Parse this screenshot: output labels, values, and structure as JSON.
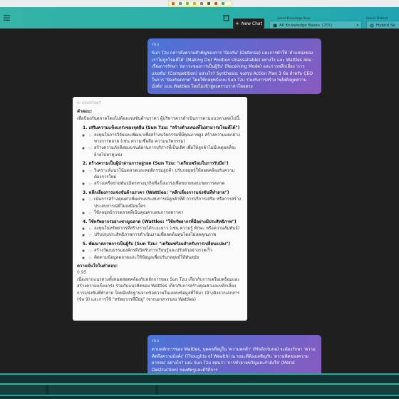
{
  "header": {
    "new_chat_label": "New Chat",
    "kb_label": "Select Knowledge Base",
    "kb_value": "All Knowledge Bases",
    "kb_count": "(201)",
    "sm_label": "Search Method",
    "sm_value": "Hybrid Se"
  },
  "messages": {
    "user1": {
      "role": "YOU",
      "text": "Sun Tzu กล่าวถึงความสำคัญของการ 'ป้องกัน' (Defense) และการทำให้ 'ตำแหน่งของเราไม่ถูกโจมตีได้' (Making Our Position Unassailable) อย่างไร และ Wattles สอนเรื่องการรักษา 'สภาวะของการเป็นผู้รับ' (Receiving Mode) และการหลีกเลี่ยง 'การแข่งขัน' (Competition) อย่างไร? Synthesis: จงสรุป Action Plan 3 ข้อ สำหรับ CEO ในการ 'ป้องกันตลาด' โดยใช้กลยุทธ์แบบ Sun Tzu ร่วมกับการสร้าง 'พลังดึงดูดความมั่งคั่ง' แบบ Wattles โดยไม่เข้าสู่สงครามราคาโดยตรง"
    },
    "ai": {
      "role": "AI ASSISTANT",
      "answer_heading": "คำตอบ:",
      "intro": "เพื่อป้องกันตลาดโดยไม่ต้องแข่งขันด้านราคา ผู้บริหารควรดำเนินการตามแนวทางต่อไปนี้:",
      "sections": [
        {
          "title": "1. เสริมความแข็งแกร่งของจุดยืน (Sun Tzu: \"สร้างตำแหน่งที่ไม่สามารถโจมตีได้\")",
          "bullets": [
            "ลงทุนในการวิจัยและพัฒนาเพื่อสร้างนวัตกรรมที่มีคุณภาพสูง สร้างความแตกต่างทางการตลาด (เช่น ความเชื่อถือ ความนวัตกรรม)",
            "สร้างความภักดีต่อแบรนด์ผ่านการบริการที่เป็นเลิศ เพื่อให้ลูกค้าไม่มีเหตุผลที่จะย้ายไปหาคู่แข่ง"
          ]
        },
        {
          "title": "2. สร้างความเป็นผู้นำผ่านการอยู่รอด (Sun Tzu: \"เตรียมพร้อมในการรับมือ\")",
          "bullets": [
            "วิเคราะห์แนวโน้มตลาดและพฤติกรรมลูกค้า ปรับกลยุทธ์ให้สอดคล้องกับความต้องการใหม่",
            "สร้างเครือข่ายพันธมิตรทางธุรกิจที่แข็งแกร่งเพื่อขยายขอบเขตการตลาด"
          ]
        },
        {
          "title": "3. หลีกเลี่ยงการแข่งขันด้านราคา (Wattles: \"หลีกเลี่ยงการแข่งขันที่ทำลาย\")",
          "bullets": [
            "เน้นการสร้างคุณค่าเพิ่มผ่านประสบการณ์ลูกค้าที่ดี การบริการเสริม หรือการสร้างประสบการณ์ที่ไม่เหมือนใคร",
            "ใช้กลยุทธ์การตลาดที่เน้นคุณค่าแทนการลดราคา"
          ]
        },
        {
          "title": "4. ใช้ทรัพยากรอย่างชาญฉลาด (Wattles: \"ใช้ทรัพยากรที่มีอย่างมีประสิทธิภาพ\")",
          "bullets": [
            "ลงทุนในทรัพยากรที่สร้างรายได้ระยะยาว (เช่น ความรู้ ทักษะ หรือความสัมพันธ์)",
            "ปรับปรุงประสิทธิภาพการดำเนินงานเพื่อลดต้นทุนโดยไม่ลดคุณภาพ"
          ]
        },
        {
          "title": "5. พัฒนาสภาพการเป็นผู้รับ (Sun Tzu: \"เตรียมพร้อมสำหรับการเปลี่ยนแปลง\")",
          "bullets": [
            "สร้างวัฒนธรรมองค์กรที่เปิดรับการเรียนรู้และปรับตัวอย่างรวดเร็ว",
            "ติดตามข้อมูลตลาดและใช้ข้อมูลเพื่อปรับกลยุทธ์ให้ทันสมัย"
          ]
        }
      ],
      "confidence_label": "ความมั่นใจในคำตอบ:",
      "confidence_value": "0.95",
      "closing": "เนื่องจากแนวทางทั้งหมดสอดคล้องกับหลักการของ Sun Tzu เกี่ยวกับการเตรียมพร้อมและสร้างความแข็งแกร่ง ร่วมกับแนวคิดของ Wattles เกี่ยวกับการสร้างคุณค่าและหลีกเลี่ยงการแข่งขันที่ทำลาย โดยมีหลักฐานจากข้อความในแหล่งข้อมูลที่ให้มา (อ้างอิงจากเอกสาร (ข้อ 9) และการใช้ \"ทรัพยากรที่มีอยู่\" (จากเอกสารของ Wattles)"
    },
    "user2": {
      "role": "YOU",
      "text": "ตามหลักการของ Wattles, บุคคลที่อยู่ใน 'ความตกต่ำ' (Misfortune) จะต้องรักษา 'ความคิดถึงความมั่งคั่ง' (Thoughts of Wealth) ณ ขณะที่ต้องเผชิญกับ 'ความคิดของความยากจน' อย่างไร? และ Sun Tzu สอนว่า 'การทำลายขวัญและกำลังใจ' (Moral Destruction) ของศัตรูและมีวิธีการ"
    }
  },
  "colors": {
    "accent_teal": "#2bb0a8",
    "user_bubble_start": "#4a74d8",
    "user_bubble_end": "#8a5ac0"
  }
}
